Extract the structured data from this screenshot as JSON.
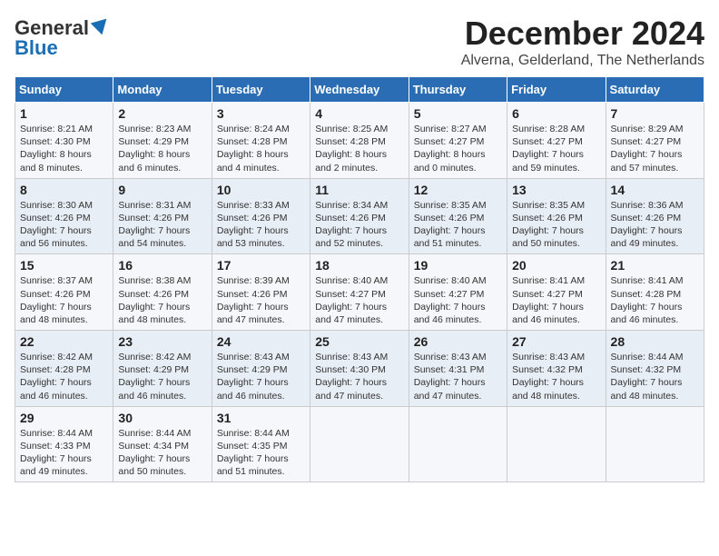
{
  "header": {
    "logo_line1": "General",
    "logo_line2": "Blue",
    "title": "December 2024",
    "subtitle": "Alverna, Gelderland, The Netherlands"
  },
  "calendar": {
    "days_of_week": [
      "Sunday",
      "Monday",
      "Tuesday",
      "Wednesday",
      "Thursday",
      "Friday",
      "Saturday"
    ],
    "weeks": [
      [
        {
          "day": "1",
          "info": "Sunrise: 8:21 AM\nSunset: 4:30 PM\nDaylight: 8 hours\nand 8 minutes."
        },
        {
          "day": "2",
          "info": "Sunrise: 8:23 AM\nSunset: 4:29 PM\nDaylight: 8 hours\nand 6 minutes."
        },
        {
          "day": "3",
          "info": "Sunrise: 8:24 AM\nSunset: 4:28 PM\nDaylight: 8 hours\nand 4 minutes."
        },
        {
          "day": "4",
          "info": "Sunrise: 8:25 AM\nSunset: 4:28 PM\nDaylight: 8 hours\nand 2 minutes."
        },
        {
          "day": "5",
          "info": "Sunrise: 8:27 AM\nSunset: 4:27 PM\nDaylight: 8 hours\nand 0 minutes."
        },
        {
          "day": "6",
          "info": "Sunrise: 8:28 AM\nSunset: 4:27 PM\nDaylight: 7 hours\nand 59 minutes."
        },
        {
          "day": "7",
          "info": "Sunrise: 8:29 AM\nSunset: 4:27 PM\nDaylight: 7 hours\nand 57 minutes."
        }
      ],
      [
        {
          "day": "8",
          "info": "Sunrise: 8:30 AM\nSunset: 4:26 PM\nDaylight: 7 hours\nand 56 minutes."
        },
        {
          "day": "9",
          "info": "Sunrise: 8:31 AM\nSunset: 4:26 PM\nDaylight: 7 hours\nand 54 minutes."
        },
        {
          "day": "10",
          "info": "Sunrise: 8:33 AM\nSunset: 4:26 PM\nDaylight: 7 hours\nand 53 minutes."
        },
        {
          "day": "11",
          "info": "Sunrise: 8:34 AM\nSunset: 4:26 PM\nDaylight: 7 hours\nand 52 minutes."
        },
        {
          "day": "12",
          "info": "Sunrise: 8:35 AM\nSunset: 4:26 PM\nDaylight: 7 hours\nand 51 minutes."
        },
        {
          "day": "13",
          "info": "Sunrise: 8:35 AM\nSunset: 4:26 PM\nDaylight: 7 hours\nand 50 minutes."
        },
        {
          "day": "14",
          "info": "Sunrise: 8:36 AM\nSunset: 4:26 PM\nDaylight: 7 hours\nand 49 minutes."
        }
      ],
      [
        {
          "day": "15",
          "info": "Sunrise: 8:37 AM\nSunset: 4:26 PM\nDaylight: 7 hours\nand 48 minutes."
        },
        {
          "day": "16",
          "info": "Sunrise: 8:38 AM\nSunset: 4:26 PM\nDaylight: 7 hours\nand 48 minutes."
        },
        {
          "day": "17",
          "info": "Sunrise: 8:39 AM\nSunset: 4:26 PM\nDaylight: 7 hours\nand 47 minutes."
        },
        {
          "day": "18",
          "info": "Sunrise: 8:40 AM\nSunset: 4:27 PM\nDaylight: 7 hours\nand 47 minutes."
        },
        {
          "day": "19",
          "info": "Sunrise: 8:40 AM\nSunset: 4:27 PM\nDaylight: 7 hours\nand 46 minutes."
        },
        {
          "day": "20",
          "info": "Sunrise: 8:41 AM\nSunset: 4:27 PM\nDaylight: 7 hours\nand 46 minutes."
        },
        {
          "day": "21",
          "info": "Sunrise: 8:41 AM\nSunset: 4:28 PM\nDaylight: 7 hours\nand 46 minutes."
        }
      ],
      [
        {
          "day": "22",
          "info": "Sunrise: 8:42 AM\nSunset: 4:28 PM\nDaylight: 7 hours\nand 46 minutes."
        },
        {
          "day": "23",
          "info": "Sunrise: 8:42 AM\nSunset: 4:29 PM\nDaylight: 7 hours\nand 46 minutes."
        },
        {
          "day": "24",
          "info": "Sunrise: 8:43 AM\nSunset: 4:29 PM\nDaylight: 7 hours\nand 46 minutes."
        },
        {
          "day": "25",
          "info": "Sunrise: 8:43 AM\nSunset: 4:30 PM\nDaylight: 7 hours\nand 47 minutes."
        },
        {
          "day": "26",
          "info": "Sunrise: 8:43 AM\nSunset: 4:31 PM\nDaylight: 7 hours\nand 47 minutes."
        },
        {
          "day": "27",
          "info": "Sunrise: 8:43 AM\nSunset: 4:32 PM\nDaylight: 7 hours\nand 48 minutes."
        },
        {
          "day": "28",
          "info": "Sunrise: 8:44 AM\nSunset: 4:32 PM\nDaylight: 7 hours\nand 48 minutes."
        }
      ],
      [
        {
          "day": "29",
          "info": "Sunrise: 8:44 AM\nSunset: 4:33 PM\nDaylight: 7 hours\nand 49 minutes."
        },
        {
          "day": "30",
          "info": "Sunrise: 8:44 AM\nSunset: 4:34 PM\nDaylight: 7 hours\nand 50 minutes."
        },
        {
          "day": "31",
          "info": "Sunrise: 8:44 AM\nSunset: 4:35 PM\nDaylight: 7 hours\nand 51 minutes."
        },
        {
          "day": "",
          "info": ""
        },
        {
          "day": "",
          "info": ""
        },
        {
          "day": "",
          "info": ""
        },
        {
          "day": "",
          "info": ""
        }
      ]
    ]
  }
}
